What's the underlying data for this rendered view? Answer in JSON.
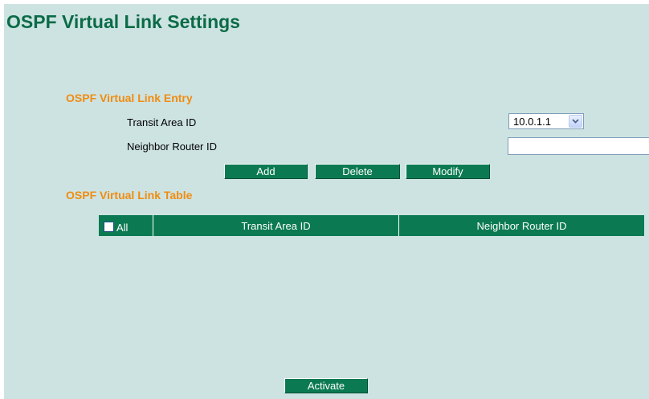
{
  "page": {
    "title": "OSPF Virtual Link Settings"
  },
  "entry": {
    "section_title": "OSPF Virtual Link Entry",
    "transit_area_label": "Transit Area ID",
    "transit_area_value": "10.0.1.1",
    "neighbor_router_label": "Neighbor Router ID",
    "neighbor_router_value": ""
  },
  "buttons": {
    "add": "Add",
    "delete": "Delete",
    "modify": "Modify",
    "activate": "Activate"
  },
  "table": {
    "section_title": "OSPF Virtual Link Table",
    "select_all_label": "All",
    "columns": [
      "Transit Area ID",
      "Neighbor Router ID"
    ],
    "rows": []
  },
  "colors": {
    "page_background": "#cde3e2",
    "title": "#0b6b46",
    "section_title": "#f08c10",
    "button_background": "#0b7a52"
  },
  "icons": {
    "dropdown": "chevron-down-icon"
  }
}
